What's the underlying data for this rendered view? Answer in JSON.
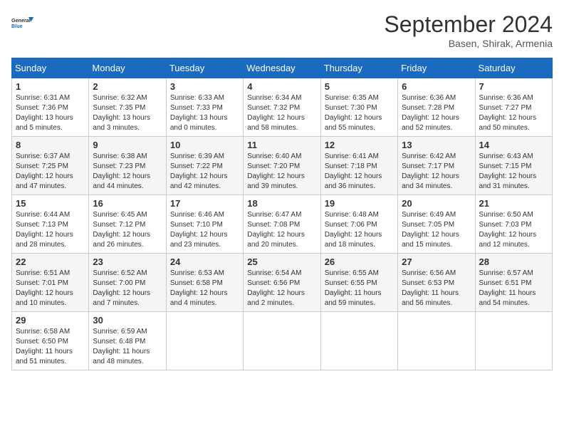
{
  "header": {
    "logo_line1": "General",
    "logo_line2": "Blue",
    "month": "September 2024",
    "location": "Basen, Shirak, Armenia"
  },
  "weekdays": [
    "Sunday",
    "Monday",
    "Tuesday",
    "Wednesday",
    "Thursday",
    "Friday",
    "Saturday"
  ],
  "weeks": [
    [
      {
        "day": "1",
        "sunrise": "6:31 AM",
        "sunset": "7:36 PM",
        "daylight": "13 hours and 5 minutes."
      },
      {
        "day": "2",
        "sunrise": "6:32 AM",
        "sunset": "7:35 PM",
        "daylight": "13 hours and 3 minutes."
      },
      {
        "day": "3",
        "sunrise": "6:33 AM",
        "sunset": "7:33 PM",
        "daylight": "13 hours and 0 minutes."
      },
      {
        "day": "4",
        "sunrise": "6:34 AM",
        "sunset": "7:32 PM",
        "daylight": "12 hours and 58 minutes."
      },
      {
        "day": "5",
        "sunrise": "6:35 AM",
        "sunset": "7:30 PM",
        "daylight": "12 hours and 55 minutes."
      },
      {
        "day": "6",
        "sunrise": "6:36 AM",
        "sunset": "7:28 PM",
        "daylight": "12 hours and 52 minutes."
      },
      {
        "day": "7",
        "sunrise": "6:36 AM",
        "sunset": "7:27 PM",
        "daylight": "12 hours and 50 minutes."
      }
    ],
    [
      {
        "day": "8",
        "sunrise": "6:37 AM",
        "sunset": "7:25 PM",
        "daylight": "12 hours and 47 minutes."
      },
      {
        "day": "9",
        "sunrise": "6:38 AM",
        "sunset": "7:23 PM",
        "daylight": "12 hours and 44 minutes."
      },
      {
        "day": "10",
        "sunrise": "6:39 AM",
        "sunset": "7:22 PM",
        "daylight": "12 hours and 42 minutes."
      },
      {
        "day": "11",
        "sunrise": "6:40 AM",
        "sunset": "7:20 PM",
        "daylight": "12 hours and 39 minutes."
      },
      {
        "day": "12",
        "sunrise": "6:41 AM",
        "sunset": "7:18 PM",
        "daylight": "12 hours and 36 minutes."
      },
      {
        "day": "13",
        "sunrise": "6:42 AM",
        "sunset": "7:17 PM",
        "daylight": "12 hours and 34 minutes."
      },
      {
        "day": "14",
        "sunrise": "6:43 AM",
        "sunset": "7:15 PM",
        "daylight": "12 hours and 31 minutes."
      }
    ],
    [
      {
        "day": "15",
        "sunrise": "6:44 AM",
        "sunset": "7:13 PM",
        "daylight": "12 hours and 28 minutes."
      },
      {
        "day": "16",
        "sunrise": "6:45 AM",
        "sunset": "7:12 PM",
        "daylight": "12 hours and 26 minutes."
      },
      {
        "day": "17",
        "sunrise": "6:46 AM",
        "sunset": "7:10 PM",
        "daylight": "12 hours and 23 minutes."
      },
      {
        "day": "18",
        "sunrise": "6:47 AM",
        "sunset": "7:08 PM",
        "daylight": "12 hours and 20 minutes."
      },
      {
        "day": "19",
        "sunrise": "6:48 AM",
        "sunset": "7:06 PM",
        "daylight": "12 hours and 18 minutes."
      },
      {
        "day": "20",
        "sunrise": "6:49 AM",
        "sunset": "7:05 PM",
        "daylight": "12 hours and 15 minutes."
      },
      {
        "day": "21",
        "sunrise": "6:50 AM",
        "sunset": "7:03 PM",
        "daylight": "12 hours and 12 minutes."
      }
    ],
    [
      {
        "day": "22",
        "sunrise": "6:51 AM",
        "sunset": "7:01 PM",
        "daylight": "12 hours and 10 minutes."
      },
      {
        "day": "23",
        "sunrise": "6:52 AM",
        "sunset": "7:00 PM",
        "daylight": "12 hours and 7 minutes."
      },
      {
        "day": "24",
        "sunrise": "6:53 AM",
        "sunset": "6:58 PM",
        "daylight": "12 hours and 4 minutes."
      },
      {
        "day": "25",
        "sunrise": "6:54 AM",
        "sunset": "6:56 PM",
        "daylight": "12 hours and 2 minutes."
      },
      {
        "day": "26",
        "sunrise": "6:55 AM",
        "sunset": "6:55 PM",
        "daylight": "11 hours and 59 minutes."
      },
      {
        "day": "27",
        "sunrise": "6:56 AM",
        "sunset": "6:53 PM",
        "daylight": "11 hours and 56 minutes."
      },
      {
        "day": "28",
        "sunrise": "6:57 AM",
        "sunset": "6:51 PM",
        "daylight": "11 hours and 54 minutes."
      }
    ],
    [
      {
        "day": "29",
        "sunrise": "6:58 AM",
        "sunset": "6:50 PM",
        "daylight": "11 hours and 51 minutes."
      },
      {
        "day": "30",
        "sunrise": "6:59 AM",
        "sunset": "6:48 PM",
        "daylight": "11 hours and 48 minutes."
      },
      null,
      null,
      null,
      null,
      null
    ]
  ]
}
